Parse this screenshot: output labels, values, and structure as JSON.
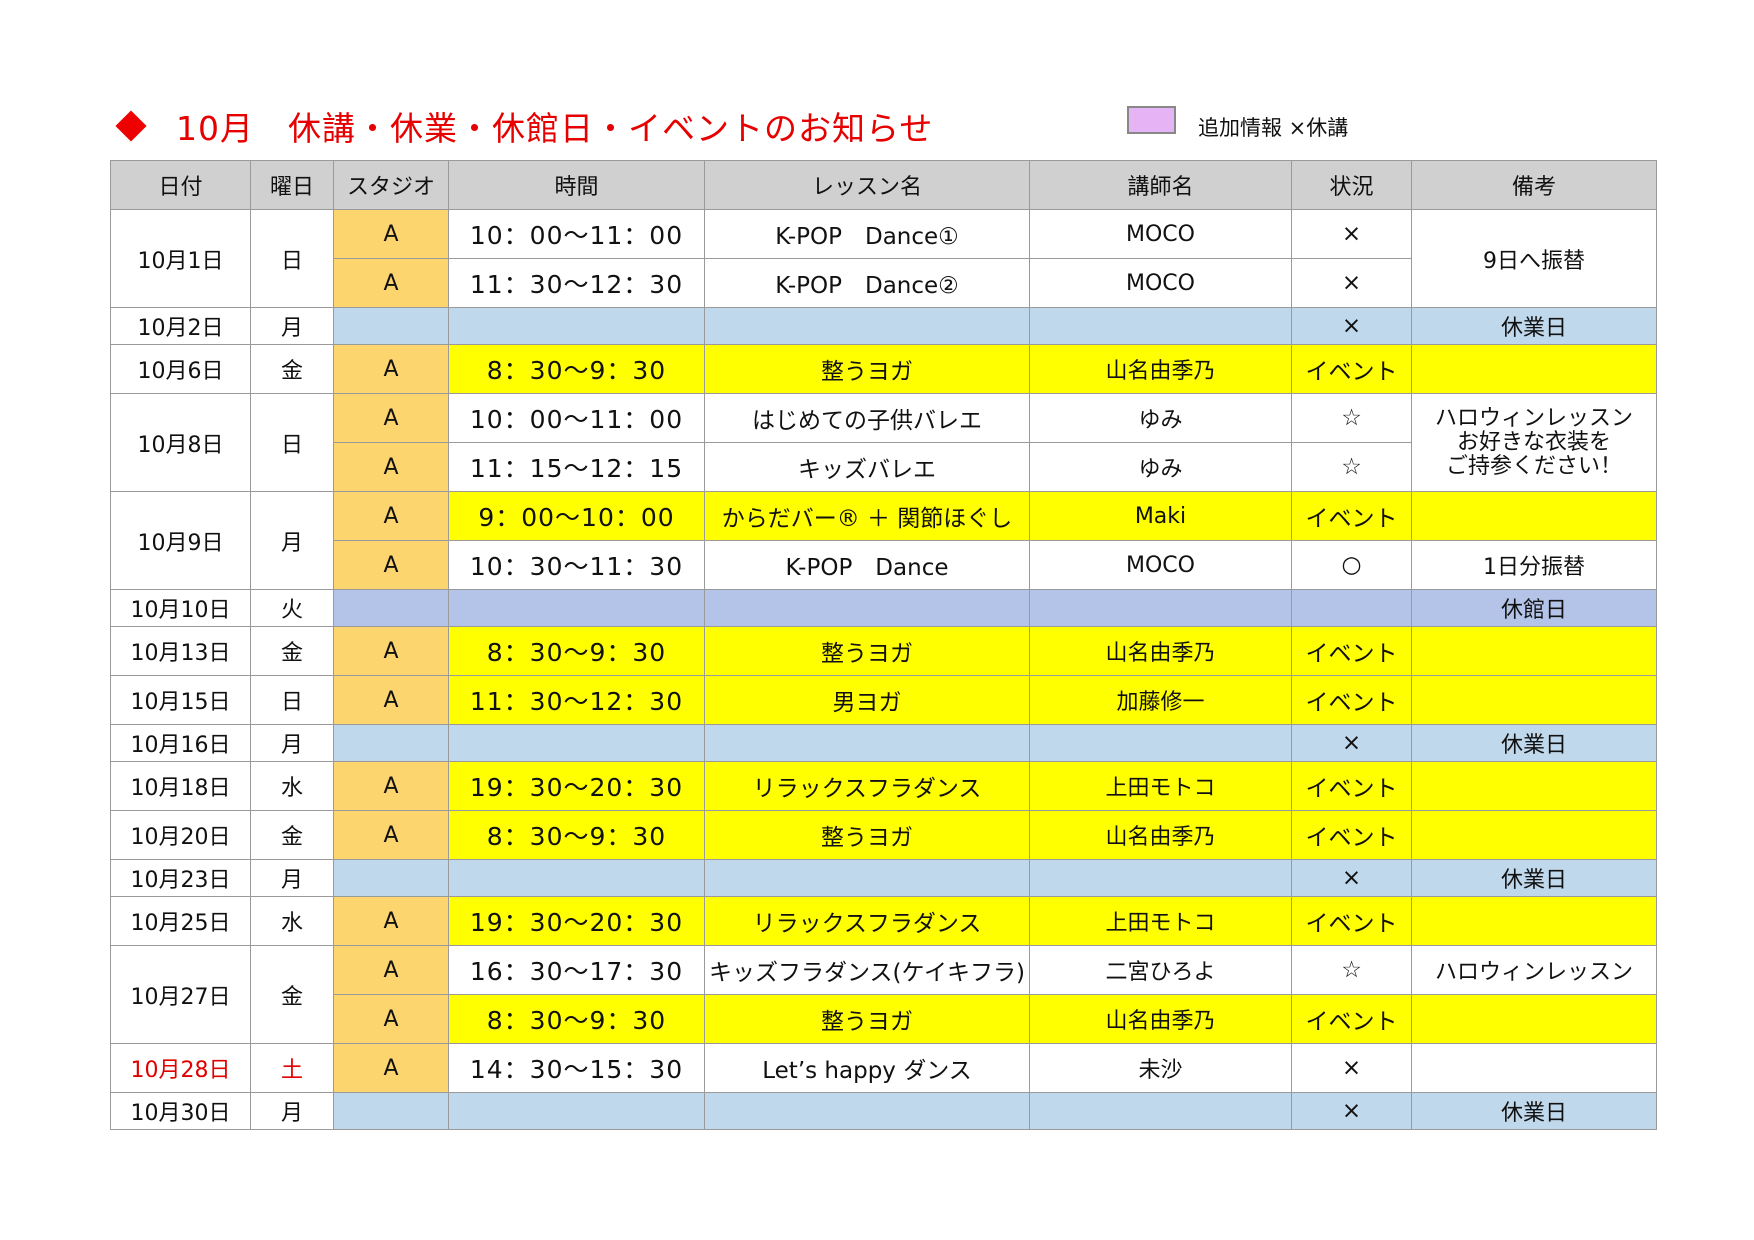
{
  "title": "10月　休講・休業・休館日・イベントのお知らせ",
  "legend": {
    "text": "追加情報 ×休講",
    "swatch_color": "#e6b3f5"
  },
  "colors": {
    "title": "#e60000",
    "studio": "#fdd56f",
    "event": "#ffff00",
    "closed": "#c0d8ec",
    "library_closed": "#b4c4e8",
    "saturday": "#e00000"
  },
  "headers": [
    "日付",
    "曜日",
    "スタジオ",
    "時間",
    "レッスン名",
    "講師名",
    "状況",
    "備考"
  ],
  "rows": [
    {
      "date": "10月1日",
      "day": "日",
      "lessons": [
        {
          "studio": "A",
          "time": "10：00〜11：00",
          "lesson": "K-POP　Dance①",
          "instructor": "MOCO",
          "status": "×"
        },
        {
          "studio": "A",
          "time": "11：30〜12：30",
          "lesson": "K-POP　Dance②",
          "instructor": "MOCO",
          "status": "×"
        }
      ],
      "note": "9日へ振替"
    },
    {
      "date": "10月2日",
      "day": "月",
      "status": "×",
      "note": "休業日"
    },
    {
      "date": "10月6日",
      "day": "金",
      "lessons": [
        {
          "studio": "A",
          "time": "8：30〜9：30",
          "lesson": "整うヨガ",
          "instructor": "山名由季乃",
          "status": "イベント",
          "note": ""
        }
      ]
    },
    {
      "date": "10月8日",
      "day": "日",
      "lessons": [
        {
          "studio": "A",
          "time": "10：00〜11：00",
          "lesson": "はじめての子供バレエ",
          "instructor": "ゆみ",
          "status": "☆"
        },
        {
          "studio": "A",
          "time": "11：15〜12：15",
          "lesson": "キッズバレエ",
          "instructor": "ゆみ",
          "status": "☆"
        }
      ],
      "note_lines": [
        "ハロウィンレッスン",
        "お好きな衣装を",
        "ご持参ください！"
      ]
    },
    {
      "date": "10月9日",
      "day": "月",
      "lessons": [
        {
          "studio": "A",
          "time": "9：00〜10：00",
          "lesson": "からだバー® ＋ 関節ほぐし",
          "instructor": "Maki",
          "status": "イベント",
          "note": ""
        },
        {
          "studio": "A",
          "time": "10：30〜11：30",
          "lesson": "K-POP　Dance",
          "instructor": "MOCO",
          "status": "○",
          "note": "1日分振替"
        }
      ]
    },
    {
      "date": "10月10日",
      "day": "火",
      "status": "",
      "note": "休館日"
    },
    {
      "date": "10月13日",
      "day": "金",
      "lessons": [
        {
          "studio": "A",
          "time": "8：30〜9：30",
          "lesson": "整うヨガ",
          "instructor": "山名由季乃",
          "status": "イベント",
          "note": ""
        }
      ]
    },
    {
      "date": "10月15日",
      "day": "日",
      "lessons": [
        {
          "studio": "A",
          "time": "11：30〜12：30",
          "lesson": "男ヨガ",
          "instructor": "加藤修一",
          "status": "イベント",
          "note": ""
        }
      ]
    },
    {
      "date": "10月16日",
      "day": "月",
      "status": "×",
      "note": "休業日"
    },
    {
      "date": "10月18日",
      "day": "水",
      "lessons": [
        {
          "studio": "A",
          "time": "19：30〜20：30",
          "lesson": "リラックスフラダンス",
          "instructor": "上田モトコ",
          "status": "イベント",
          "note": ""
        }
      ]
    },
    {
      "date": "10月20日",
      "day": "金",
      "lessons": [
        {
          "studio": "A",
          "time": "8：30〜9：30",
          "lesson": "整うヨガ",
          "instructor": "山名由季乃",
          "status": "イベント",
          "note": ""
        }
      ]
    },
    {
      "date": "10月23日",
      "day": "月",
      "status": "×",
      "note": "休業日"
    },
    {
      "date": "10月25日",
      "day": "水",
      "lessons": [
        {
          "studio": "A",
          "time": "19：30〜20：30",
          "lesson": "リラックスフラダンス",
          "instructor": "上田モトコ",
          "status": "イベント",
          "note": ""
        }
      ]
    },
    {
      "date": "10月27日",
      "day": "金",
      "lessons": [
        {
          "studio": "A",
          "time": "16：30〜17：30",
          "lesson": "キッズフラダンス(ケイキフラ)",
          "instructor": "二宮ひろよ",
          "status": "☆",
          "note": "ハロウィンレッスン"
        },
        {
          "studio": "A",
          "time": "8：30〜9：30",
          "lesson": "整うヨガ",
          "instructor": "山名由季乃",
          "status": "イベント",
          "note": ""
        }
      ]
    },
    {
      "date": "10月28日",
      "day": "土",
      "lessons": [
        {
          "studio": "A",
          "time": "14：30〜15：30",
          "lesson": "Let’s happy ダンス",
          "instructor": "未沙",
          "status": "×",
          "note": ""
        }
      ]
    },
    {
      "date": "10月30日",
      "day": "月",
      "status": "×",
      "note": "休業日"
    }
  ]
}
